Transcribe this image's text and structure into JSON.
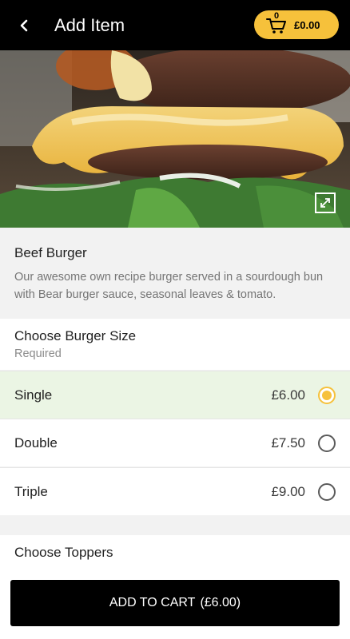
{
  "header": {
    "title": "Add Item",
    "back_icon": "chevron-left-icon"
  },
  "cart": {
    "count": "0",
    "total": "£0.00",
    "icon": "cart-icon",
    "accent": "#f6c13b"
  },
  "item": {
    "name": "Beef Burger",
    "description": "Our awesome own recipe burger served in a sourdough bun with Bear burger sauce, seasonal leaves & tomato."
  },
  "size_group": {
    "title": "Choose Burger Size",
    "subtitle": "Required",
    "options": [
      {
        "label": "Single",
        "price": "£6.00",
        "selected": true
      },
      {
        "label": "Double",
        "price": "£7.50",
        "selected": false
      },
      {
        "label": "Triple",
        "price": "£9.00",
        "selected": false
      }
    ]
  },
  "toppers_group": {
    "title": "Choose Toppers"
  },
  "add_to_cart": {
    "label": "ADD TO CART",
    "price": "(£6.00)"
  },
  "colors": {
    "header_bg": "#000000",
    "selected_bg": "#ebf5e4",
    "radio_on": "#f6c13b"
  }
}
